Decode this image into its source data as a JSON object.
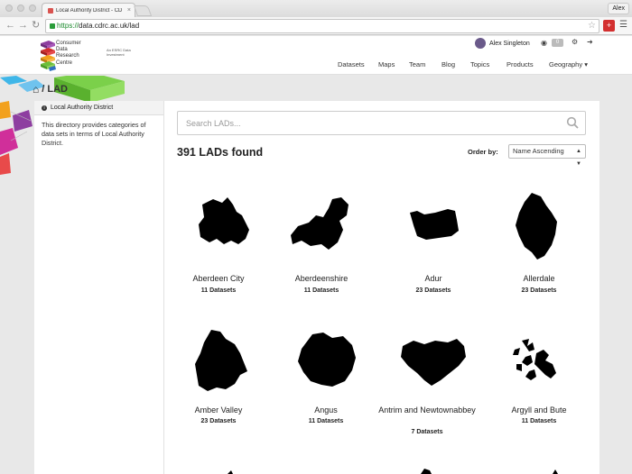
{
  "browser": {
    "tab_title": "Local Authority District - CD",
    "user_chip": "Alex",
    "url_scheme": "https://",
    "url_host": "data.cdrc.ac.uk/lad"
  },
  "site": {
    "logo_lines": [
      "Consumer",
      "Data",
      "Research",
      "Centre"
    ],
    "logo_sub": "An ESRC Data Investment",
    "user_name": "Alex Singleton",
    "badge_count": "0",
    "nav": [
      {
        "label": "Datasets"
      },
      {
        "label": "Maps"
      },
      {
        "label": "Team"
      },
      {
        "label": "Blog"
      },
      {
        "label": "Topics"
      },
      {
        "label": "Products"
      },
      {
        "label": "Geography ▾"
      }
    ]
  },
  "breadcrumb": {
    "current": "LAD"
  },
  "sidebar": {
    "heading": "Local Authority District",
    "description": "This directory provides categories of data sets in terms of Local Authority District."
  },
  "main": {
    "search_placeholder": "Search LADs...",
    "result_count": "391 LADs found",
    "order_label": "Order by:",
    "order_value": "Name Ascending",
    "items": [
      {
        "name": "Aberdeen City",
        "datasets": "11 Datasets"
      },
      {
        "name": "Aberdeenshire",
        "datasets": "11 Datasets"
      },
      {
        "name": "Adur",
        "datasets": "23 Datasets"
      },
      {
        "name": "Allerdale",
        "datasets": "23 Datasets"
      },
      {
        "name": "Amber Valley",
        "datasets": "23 Datasets"
      },
      {
        "name": "Angus",
        "datasets": "11 Datasets"
      },
      {
        "name": "Antrim and Newtownabbey",
        "datasets": "7 Datasets"
      },
      {
        "name": "Argyll and Bute",
        "datasets": "11 Datasets"
      }
    ]
  },
  "colors": {
    "accent_green": "#1a8a2c",
    "shape": "#000000"
  }
}
